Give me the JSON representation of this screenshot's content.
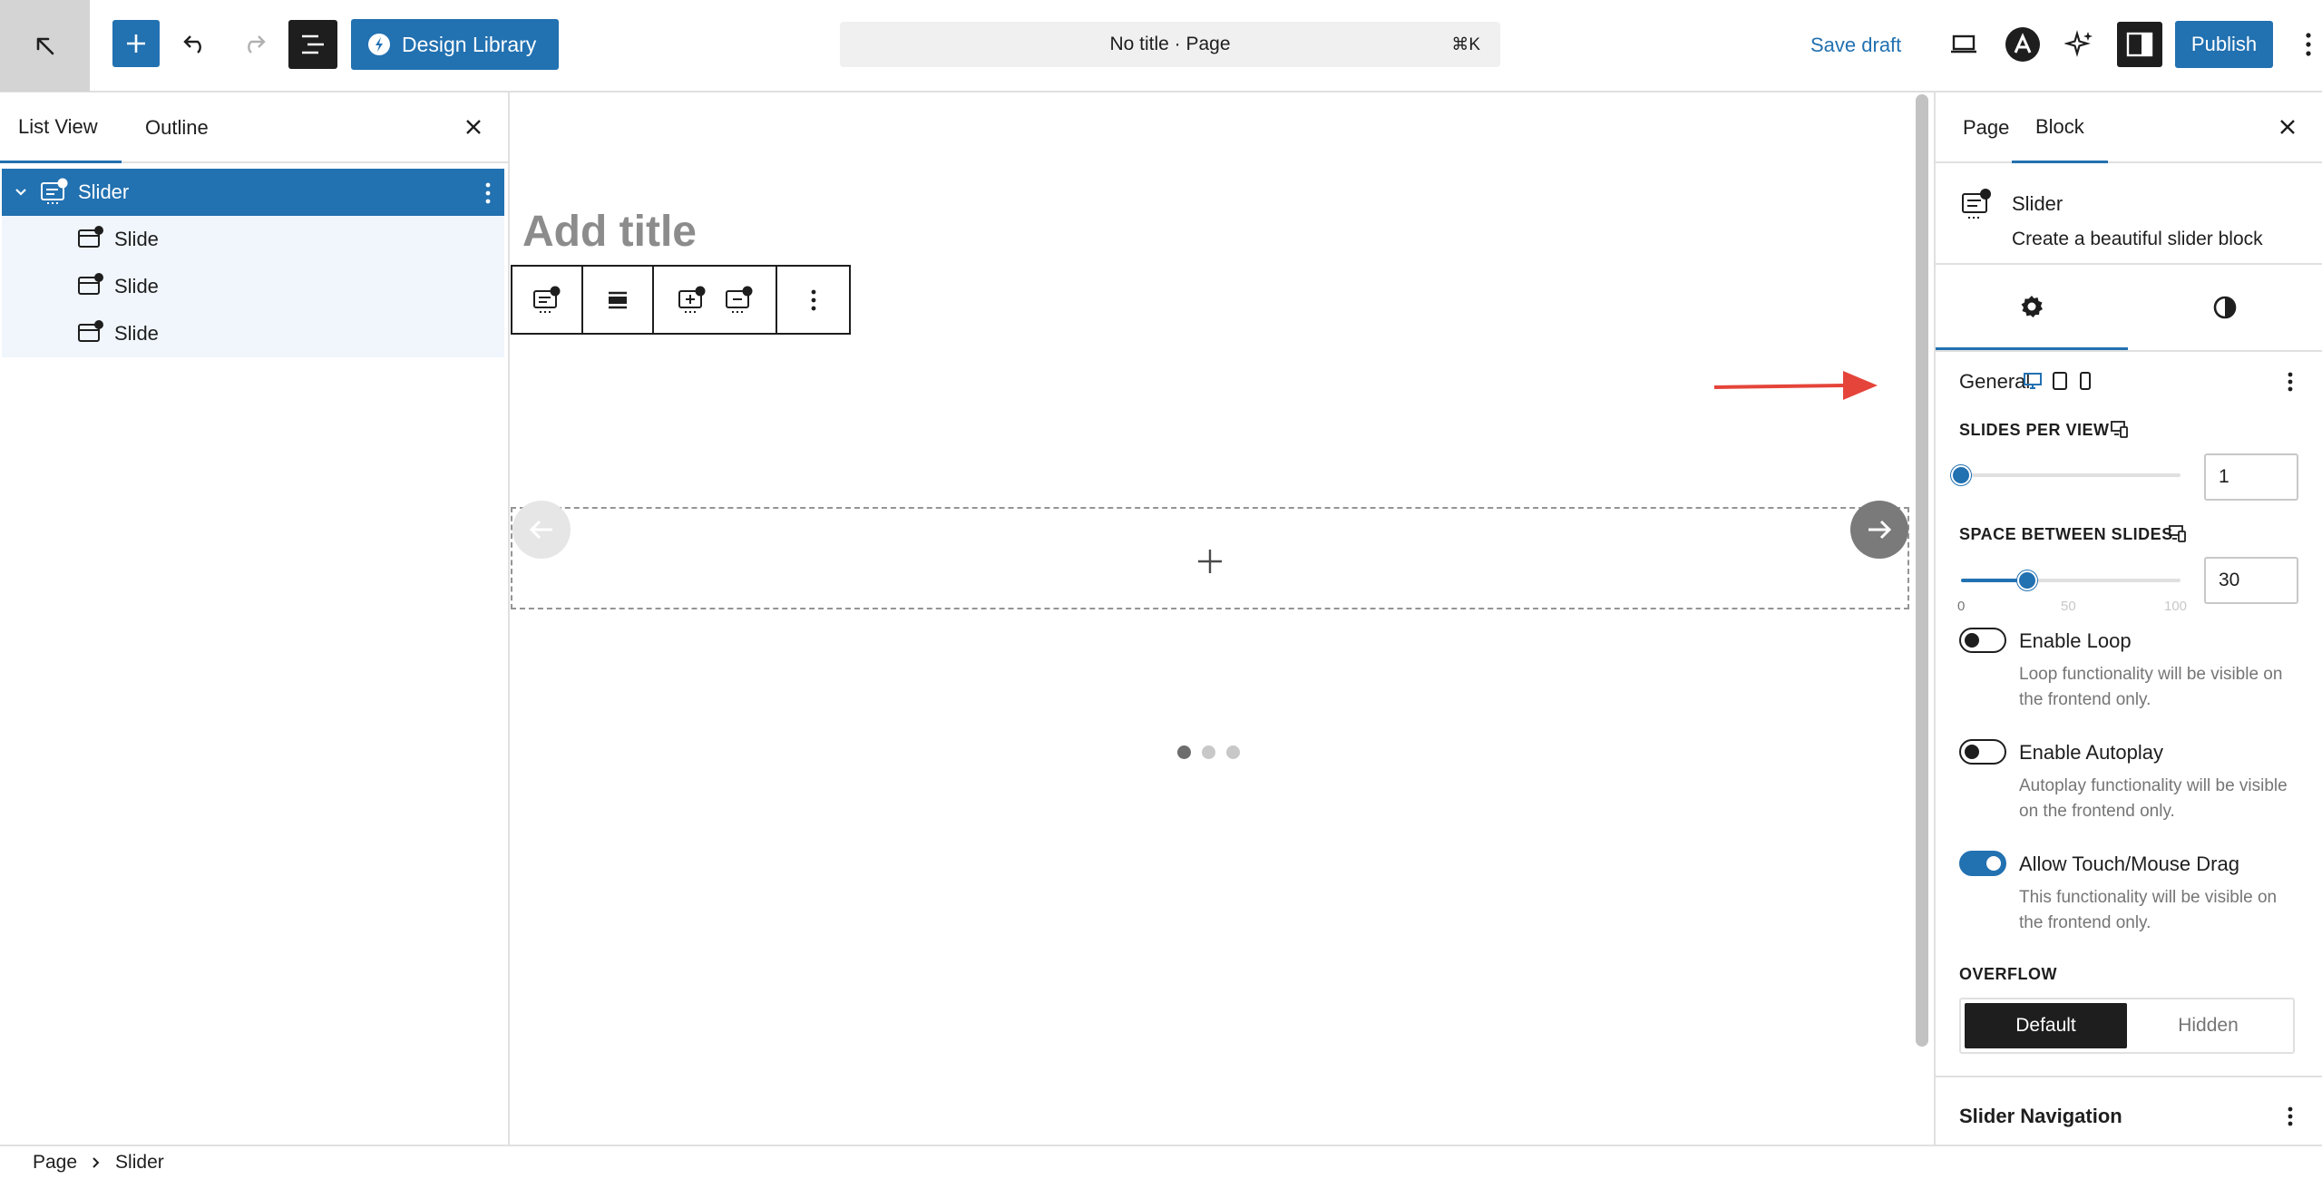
{
  "topbar": {
    "design_library_label": "Design Library",
    "command_bar_text": "No title · Page",
    "command_shortcut": "⌘K",
    "save_draft_label": "Save draft",
    "publish_label": "Publish",
    "accent_color": "#2271b1"
  },
  "left_panel": {
    "tabs": [
      "List View",
      "Outline"
    ],
    "tree": {
      "parent": "Slider",
      "children": [
        "Slide",
        "Slide",
        "Slide"
      ]
    }
  },
  "canvas": {
    "title_placeholder": "Add title",
    "slider_dots": 3,
    "active_dot": 1
  },
  "right_panel": {
    "tabs": [
      "Page",
      "Block"
    ],
    "block_name": "Slider",
    "block_description": "Create a beautiful slider block",
    "general_title": "General",
    "slides_per_view": {
      "label": "SLIDES PER VIEW",
      "value": "1",
      "fraction": 0
    },
    "space_between": {
      "label": "SPACE BETWEEN SLIDES",
      "value": "30",
      "min_label": "0",
      "mid_label": "50",
      "max_label": "100",
      "fraction": 0.3
    },
    "toggles": [
      {
        "label": "Enable Loop",
        "help": "Loop functionality will be visible on the frontend only.",
        "on": false
      },
      {
        "label": "Enable Autoplay",
        "help": "Autoplay functionality will be visible on the frontend only.",
        "on": false
      },
      {
        "label": "Allow Touch/Mouse Drag",
        "help": "This functionality will be visible on the frontend only.",
        "on": true
      }
    ],
    "overflow": {
      "label": "OVERFLOW",
      "options": [
        "Default",
        "Hidden"
      ],
      "selected": "Default"
    },
    "navigation_title": "Slider Navigation"
  },
  "breadcrumb": {
    "items": [
      "Page",
      "Slider"
    ]
  }
}
